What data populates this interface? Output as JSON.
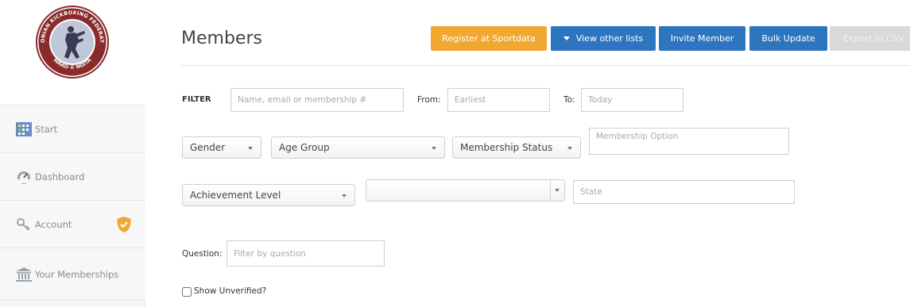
{
  "sidebar": {
    "logo": {
      "ring_text_top": "ESTONIAN KICKBOXING FEDERATION",
      "ring_text_bottom": "WAKO © NOITA",
      "colors": {
        "ring": "#8a2a2a",
        "field": "#bfc7d8"
      }
    },
    "items": [
      {
        "label": "Start",
        "icon": "grid-icon"
      },
      {
        "label": "Dashboard",
        "icon": "dashboard-icon"
      },
      {
        "label": "Account",
        "icon": "key-icon",
        "badge": "shield-check-icon"
      },
      {
        "label": "Your Memberships",
        "icon": "institution-icon"
      }
    ]
  },
  "header": {
    "title": "Members",
    "buttons": {
      "register": "Register at Sportdata",
      "view_lists": "View other lists",
      "invite": "Invite Member",
      "bulk": "Bulk Update",
      "export": "Export to CSV"
    }
  },
  "filters": {
    "label": "FILTER",
    "search_placeholder": "Name, email or membership #",
    "from_label": "From:",
    "from_placeholder": "Earliest",
    "to_label": "To:",
    "to_placeholder": "Today",
    "gender": "Gender",
    "age_group": "Age Group",
    "membership_status": "Membership Status",
    "membership_option_placeholder": "Membership Option",
    "achievement_level": "Achievement Level",
    "empty_select": "",
    "state_placeholder": "State",
    "question_label": "Question:",
    "question_placeholder": "Filter by question",
    "show_unverified": "Show Unverified?"
  },
  "colors": {
    "orange": "#f0a830",
    "blue": "#2e75c0",
    "disabled": "#d9d9d9"
  }
}
